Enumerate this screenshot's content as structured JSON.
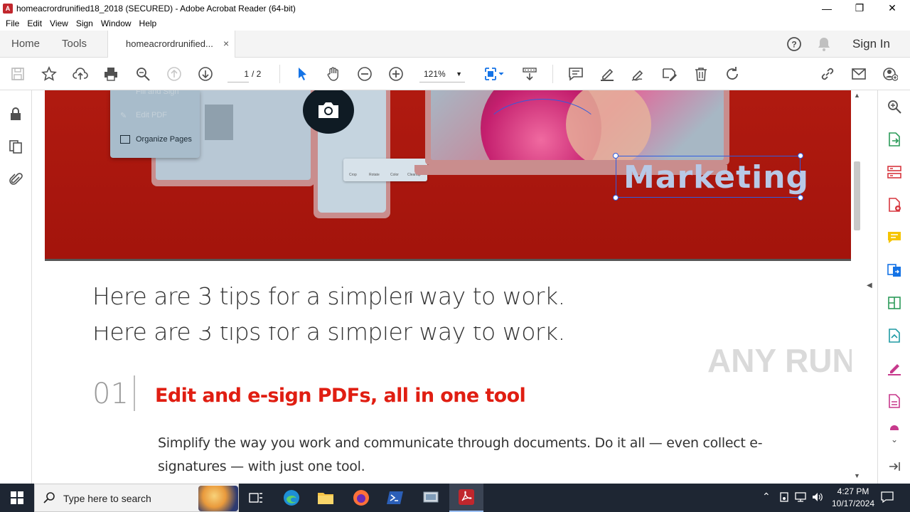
{
  "window": {
    "title": "homeacrordrunified18_2018 (SECURED) - Adobe Acrobat Reader (64-bit)",
    "minimize": "—",
    "maximize": "❐",
    "close": "✕"
  },
  "menu": [
    "File",
    "Edit",
    "View",
    "Sign",
    "Window",
    "Help"
  ],
  "tabs": {
    "home": "Home",
    "tools": "Tools",
    "document": "homeacrordrunified...",
    "close": "×",
    "sign_in": "Sign In"
  },
  "toolbar": {
    "page_current": "1",
    "page_total": "/ 2",
    "zoom": "121%",
    "icons": [
      "save-icon",
      "star-icon",
      "upload-icon",
      "print-icon",
      "search-icon",
      "page-up-icon",
      "page-down-icon",
      "select-icon",
      "hand-icon",
      "zoom-out-icon",
      "zoom-in-icon",
      "fit-page-icon",
      "scroll-mode-icon",
      "comment-icon",
      "highlight-icon",
      "sign-icon",
      "edit-icon",
      "delete-icon",
      "rotate-icon",
      "link-icon",
      "mail-icon",
      "share-icon"
    ]
  },
  "banner": {
    "menu_items": [
      "Fill and Sign",
      "Edit PDF",
      "Organize Pages"
    ],
    "tool_labels": [
      "Crop",
      "Rotate",
      "Color",
      "Cleanup"
    ],
    "marketing_text": "Marketing"
  },
  "content": {
    "heading": "Here are 3 tips for a simpler way to work.",
    "heading_ghost": "Here are 3 tips for a simpler way to work.",
    "section_num": "01",
    "section_title": "Edit and e-sign PDFs, all in one tool",
    "section_body": "Simplify the way you work and communicate through documents. Do it all — even collect e-signatures — with just one tool."
  },
  "watermark": "ANY RUN",
  "taskbar": {
    "search_placeholder": "Type here to search",
    "time": "4:27 PM",
    "date": "10/17/2024"
  },
  "colors": {
    "banner_red": "#a3140c",
    "accent_blue": "#1473e6",
    "section_red": "#e01e12"
  }
}
